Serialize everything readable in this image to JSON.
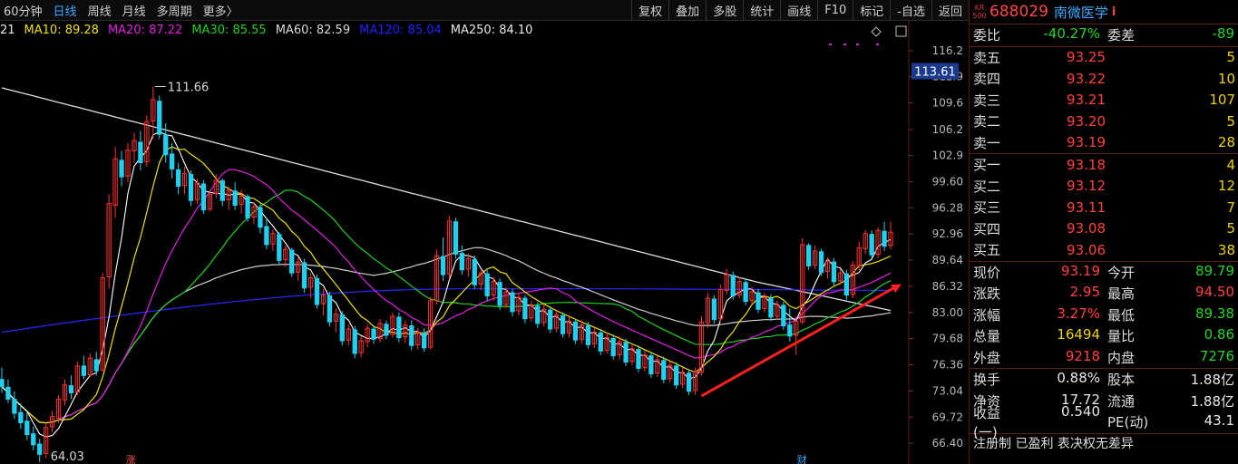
{
  "toolbar": {
    "periods": [
      "60分钟",
      "日线",
      "周线",
      "月线",
      "多周期",
      "更多〉"
    ],
    "active_period": "日线",
    "tools": [
      "复权",
      "叠加",
      "多股",
      "统计",
      "画线",
      "F10",
      "标记",
      "-自选",
      "返回"
    ]
  },
  "ma_legend": [
    {
      "label": "21",
      "color": "#e8e8e8"
    },
    {
      "label": "MA10: 89.28",
      "color": "#f0e000"
    },
    {
      "label": "MA20: 87.22",
      "color": "#e020e0"
    },
    {
      "label": "MA30: 85.55",
      "color": "#20d020"
    },
    {
      "label": "MA60: 82.59",
      "color": "#d8d8d8"
    },
    {
      "label": "MA120: 85.04",
      "color": "#2020ff"
    },
    {
      "label": "MA250: 84.10",
      "color": "#e8e8e8"
    }
  ],
  "chart_data": {
    "type": "candlestick",
    "y_ticks": [
      "116.2",
      "112.9",
      "109.6",
      "106.2",
      "102.9",
      "99.60",
      "96.28",
      "92.96",
      "89.64",
      "86.32",
      "83.00",
      "79.68",
      "76.36",
      "73.04",
      "69.72",
      "66.40"
    ],
    "ylim": [
      64.0,
      116.2
    ],
    "current_price_label": "113.61",
    "high_annotation": "111.66",
    "low_annotation": "64.03",
    "bottom_markers": [
      "涨",
      "财"
    ],
    "colors": {
      "up": "#ff3030",
      "down": "#20d0f0",
      "ma5": "#ffffff",
      "ma10": "#f0e000",
      "ma20": "#e020e0",
      "ma30": "#20d020",
      "ma60": "#d0d0d0",
      "ma120": "#2828ff",
      "ma250": "#e0e0e0",
      "arrow": "#ff2020"
    },
    "candles": [
      [
        74.5,
        76,
        72.8,
        73.6
      ],
      [
        73.5,
        74.5,
        71.5,
        72.0
      ],
      [
        72.0,
        73,
        69.5,
        70.2
      ],
      [
        70.3,
        71.5,
        68.2,
        69.0
      ],
      [
        69.2,
        70.5,
        66.8,
        67.5
      ],
      [
        67.6,
        68.5,
        65.5,
        66.2
      ],
      [
        66.3,
        67,
        64.03,
        65.0
      ],
      [
        65.1,
        69,
        64.5,
        68.4
      ],
      [
        68.5,
        70.5,
        67.8,
        69.8
      ],
      [
        69.6,
        72.5,
        69,
        72.0
      ],
      [
        71.9,
        74.5,
        71.2,
        73.8
      ],
      [
        73.7,
        75,
        72,
        72.8
      ],
      [
        72.9,
        76.8,
        72.5,
        76.2
      ],
      [
        76.2,
        77.5,
        74.5,
        75.0
      ],
      [
        75.1,
        77.8,
        74.8,
        77.2
      ],
      [
        77.0,
        78,
        75,
        75.6
      ],
      [
        75.7,
        88,
        75.5,
        87.4
      ],
      [
        87.5,
        98,
        86,
        96.8
      ],
      [
        96.6,
        104,
        95,
        102.5
      ],
      [
        102.3,
        103.5,
        99,
        100.2
      ],
      [
        100.3,
        104.5,
        99.5,
        103.6
      ],
      [
        103.5,
        105.8,
        102,
        104.8
      ],
      [
        104.6,
        106,
        101,
        102.0
      ],
      [
        102.1,
        108,
        101.5,
        107.2
      ],
      [
        107.3,
        111.66,
        105,
        110.0
      ],
      [
        109.8,
        110.5,
        105,
        105.6
      ],
      [
        105.5,
        107,
        102,
        103.0
      ],
      [
        103.1,
        104.5,
        100,
        101.2
      ],
      [
        101.1,
        102,
        98,
        99.0
      ],
      [
        99.1,
        101.5,
        98,
        100.6
      ],
      [
        100.5,
        101,
        96.5,
        97.2
      ],
      [
        97.3,
        100,
        96.8,
        99.4
      ],
      [
        99.3,
        99.8,
        95.5,
        96.0
      ],
      [
        96.1,
        98.5,
        95.8,
        98.0
      ],
      [
        98.1,
        100.5,
        97.5,
        99.8
      ],
      [
        99.7,
        100,
        96.5,
        97.2
      ],
      [
        97.3,
        99,
        96,
        98.5
      ],
      [
        98.4,
        99.5,
        96,
        96.6
      ],
      [
        96.7,
        98.5,
        95.5,
        97.8
      ],
      [
        97.7,
        98,
        94.5,
        95.0
      ],
      [
        95.1,
        97,
        94.2,
        96.4
      ],
      [
        96.3,
        96.8,
        93,
        93.8
      ],
      [
        93.9,
        95,
        91,
        91.6
      ],
      [
        91.7,
        93.5,
        90.8,
        93.0
      ],
      [
        92.9,
        93.2,
        89,
        89.6
      ],
      [
        89.7,
        91.5,
        88.8,
        91.0
      ],
      [
        90.9,
        91.2,
        87.5,
        88.0
      ],
      [
        88.1,
        90,
        87,
        89.4
      ],
      [
        89.3,
        89.8,
        85.5,
        86.1
      ],
      [
        86.2,
        88,
        84.8,
        87.4
      ],
      [
        87.3,
        87.8,
        83.5,
        84.0
      ],
      [
        84.1,
        86,
        82.6,
        85.2
      ],
      [
        85.1,
        85.6,
        81.2,
        81.8
      ],
      [
        81.9,
        83.5,
        80.5,
        82.8
      ],
      [
        82.7,
        83.2,
        78.8,
        79.4
      ],
      [
        79.5,
        81.5,
        78.8,
        80.9
      ],
      [
        80.8,
        81.3,
        77.2,
        77.8
      ],
      [
        77.9,
        80,
        77.3,
        79.4
      ],
      [
        79.3,
        81.5,
        78.6,
        81.0
      ],
      [
        80.9,
        81.4,
        79,
        79.6
      ],
      [
        79.7,
        82.2,
        79.2,
        81.6
      ],
      [
        81.5,
        82,
        79.6,
        80.1
      ],
      [
        80.2,
        83,
        79.8,
        82.5
      ],
      [
        82.4,
        83,
        79.2,
        79.8
      ],
      [
        79.9,
        82,
        79.1,
        81.4
      ],
      [
        81.3,
        82,
        78.2,
        78.8
      ],
      [
        78.9,
        81,
        78.3,
        80.5
      ],
      [
        80.4,
        81,
        78,
        78.5
      ],
      [
        78.6,
        85,
        78.3,
        84.5
      ],
      [
        84.5,
        91,
        84,
        90.2
      ],
      [
        90.1,
        92.5,
        87,
        87.8
      ],
      [
        87.9,
        95.3,
        87.2,
        94.6
      ],
      [
        94.5,
        95,
        89.8,
        90.4
      ],
      [
        90.5,
        91.5,
        87.8,
        88.4
      ],
      [
        88.5,
        90.5,
        87.5,
        89.8
      ],
      [
        89.7,
        90.2,
        86,
        86.5
      ],
      [
        86.6,
        88.5,
        85.8,
        88.0
      ],
      [
        87.9,
        88.4,
        84.5,
        85.1
      ],
      [
        85.2,
        87.5,
        84.5,
        86.9
      ],
      [
        86.8,
        87.3,
        83.3,
        83.9
      ],
      [
        84.0,
        86.2,
        83.5,
        85.6
      ],
      [
        85.5,
        86,
        82.5,
        83.1
      ],
      [
        83.2,
        85.5,
        82.6,
        84.9
      ],
      [
        84.8,
        85.2,
        81.6,
        82.2
      ],
      [
        82.3,
        84.5,
        81.8,
        83.9
      ],
      [
        83.8,
        84.3,
        81,
        81.6
      ],
      [
        81.7,
        84,
        81.2,
        83.4
      ],
      [
        83.3,
        83.8,
        80.4,
        80.9
      ],
      [
        81.0,
        83.2,
        80.5,
        82.7
      ],
      [
        82.6,
        83,
        79.8,
        80.3
      ],
      [
        80.4,
        82.5,
        79.8,
        81.9
      ],
      [
        81.8,
        82.2,
        79,
        79.5
      ],
      [
        79.6,
        82,
        79,
        81.4
      ],
      [
        81.3,
        81.8,
        78.4,
        78.9
      ],
      [
        79.0,
        81,
        78.5,
        80.5
      ],
      [
        80.4,
        80.9,
        77.6,
        78.1
      ],
      [
        78.2,
        80.5,
        77.8,
        79.8
      ],
      [
        79.7,
        80.2,
        77,
        77.5
      ],
      [
        77.6,
        80,
        77,
        79.3
      ],
      [
        79.2,
        79.7,
        76.2,
        76.7
      ],
      [
        76.8,
        79,
        76.3,
        78.4
      ],
      [
        78.3,
        78.8,
        75.4,
        75.9
      ],
      [
        76.0,
        78.2,
        75.5,
        77.6
      ],
      [
        77.5,
        78,
        74.7,
        75.2
      ],
      [
        75.3,
        77.5,
        74.8,
        77.0
      ],
      [
        76.9,
        77.4,
        74,
        74.5
      ],
      [
        74.6,
        76.8,
        74.1,
        76.3
      ],
      [
        76.2,
        76.7,
        73.3,
        73.8
      ],
      [
        73.9,
        76,
        73.4,
        75.4
      ],
      [
        75.3,
        75.8,
        72.5,
        73.0
      ],
      [
        73.1,
        76,
        72.6,
        75.5
      ],
      [
        75.4,
        82.5,
        75,
        81.8
      ],
      [
        81.7,
        85.5,
        81,
        84.8
      ],
      [
        84.7,
        85.2,
        81.6,
        82.1
      ],
      [
        82.2,
        86.5,
        81.8,
        85.9
      ],
      [
        85.8,
        88.5,
        85.3,
        87.8
      ],
      [
        87.7,
        88.2,
        84.6,
        85.1
      ],
      [
        85.2,
        87.5,
        84.8,
        86.9
      ],
      [
        86.8,
        87.3,
        83.9,
        84.4
      ],
      [
        84.5,
        86.2,
        84,
        85.6
      ],
      [
        85.5,
        86,
        82.9,
        83.4
      ],
      [
        83.5,
        85.5,
        83,
        84.9
      ],
      [
        84.8,
        85.3,
        81.9,
        82.4
      ],
      [
        82.5,
        84.5,
        82,
        84.0
      ],
      [
        83.9,
        84.4,
        80.8,
        81.3
      ],
      [
        81.4,
        83.5,
        79.3,
        80.0
      ],
      [
        80.1,
        82.5,
        77.6,
        81.9
      ],
      [
        81.8,
        92.4,
        81.5,
        91.6
      ],
      [
        91.5,
        91.8,
        88.4,
        88.9
      ],
      [
        89.0,
        91.5,
        88.5,
        90.8
      ],
      [
        90.7,
        91.1,
        87.6,
        88.1
      ],
      [
        88.2,
        90,
        87.3,
        89.5
      ],
      [
        89.4,
        89.9,
        86.4,
        86.9
      ],
      [
        87.0,
        88.5,
        86.5,
        88.0
      ],
      [
        87.9,
        88.4,
        84.6,
        85.2
      ],
      [
        85.3,
        89.5,
        84.8,
        89.0
      ],
      [
        88.9,
        92,
        88.3,
        91.2
      ],
      [
        91.1,
        93.5,
        90.4,
        93.0
      ],
      [
        92.9,
        93.4,
        89.8,
        90.3
      ],
      [
        90.4,
        93.8,
        89.9,
        93.4
      ],
      [
        93.3,
        94.5,
        90.8,
        91.4
      ],
      [
        91.5,
        94.5,
        91,
        93.19
      ]
    ]
  },
  "panel": {
    "kr_line1": "KR",
    "kr_line2": "500",
    "code": "688029",
    "name": "南微医学",
    "info_icon": "i",
    "weibi": {
      "label": "委比",
      "value": "-40.27%",
      "label2": "委差",
      "value2": "-89"
    },
    "sell": [
      {
        "label": "卖五",
        "price": "93.25",
        "vol": "5"
      },
      {
        "label": "卖四",
        "price": "93.22",
        "vol": "10"
      },
      {
        "label": "卖三",
        "price": "93.21",
        "vol": "107"
      },
      {
        "label": "卖二",
        "price": "93.20",
        "vol": "5"
      },
      {
        "label": "卖一",
        "price": "93.19",
        "vol": "28"
      }
    ],
    "buy": [
      {
        "label": "买一",
        "price": "93.18",
        "vol": "4"
      },
      {
        "label": "买二",
        "price": "93.12",
        "vol": "12"
      },
      {
        "label": "买三",
        "price": "93.11",
        "vol": "7"
      },
      {
        "label": "买四",
        "price": "93.08",
        "vol": "5"
      },
      {
        "label": "买五",
        "price": "93.06",
        "vol": "38"
      }
    ],
    "stats": [
      [
        {
          "l": "现价",
          "v": "93.19",
          "c": "red"
        },
        {
          "l": "今开",
          "v": "89.79",
          "c": "green"
        }
      ],
      [
        {
          "l": "涨跌",
          "v": "2.95",
          "c": "red"
        },
        {
          "l": "最高",
          "v": "94.50",
          "c": "red"
        }
      ],
      [
        {
          "l": "涨幅",
          "v": "3.27%",
          "c": "red"
        },
        {
          "l": "最低",
          "v": "89.38",
          "c": "green"
        }
      ],
      [
        {
          "l": "总量",
          "v": "16494",
          "c": "yellow"
        },
        {
          "l": "量比",
          "v": "0.86",
          "c": "green"
        }
      ],
      [
        {
          "l": "外盘",
          "v": "9218",
          "c": "red"
        },
        {
          "l": "内盘",
          "v": "7276",
          "c": "green"
        }
      ]
    ],
    "stats2": [
      [
        {
          "l": "换手",
          "v": "0.88%",
          "c": "white"
        },
        {
          "l": "股本",
          "v": "1.88亿",
          "c": "white"
        }
      ],
      [
        {
          "l": "净资",
          "v": "17.72",
          "c": "white"
        },
        {
          "l": "流通",
          "v": "1.88亿",
          "c": "white"
        }
      ],
      [
        {
          "l": "收益(一)",
          "v": "0.540",
          "c": "white"
        },
        {
          "l": "PE(动)",
          "v": "43.1",
          "c": "white"
        }
      ]
    ],
    "footer": "注册制 已盈利 表决权无差异"
  }
}
